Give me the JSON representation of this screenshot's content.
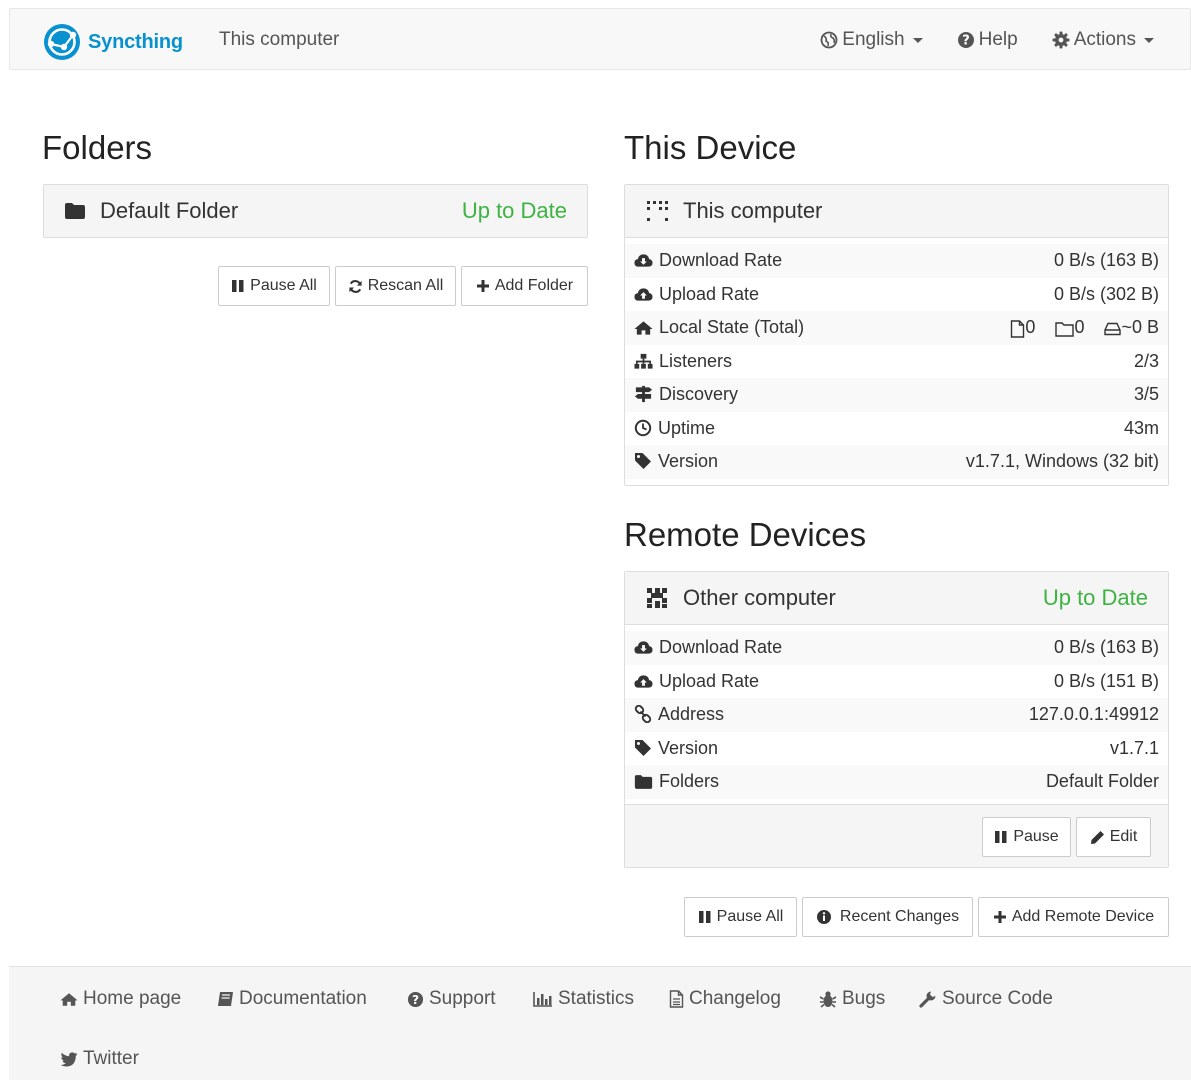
{
  "navbar": {
    "brand": "Syncthing",
    "device_name": "This computer",
    "language": "English",
    "help": "Help",
    "actions": "Actions"
  },
  "folders": {
    "heading": "Folders",
    "items": [
      {
        "name": "Default Folder",
        "status": "Up to Date"
      }
    ],
    "buttons": {
      "pause_all": "Pause All",
      "rescan_all": "Rescan All",
      "add_folder": "Add Folder"
    }
  },
  "this_device": {
    "heading": "This Device",
    "name": "This computer",
    "rows": [
      {
        "icon": "cloud-download-icon",
        "label": "Download Rate",
        "value": "0 B/s (163 B)"
      },
      {
        "icon": "cloud-upload-icon",
        "label": "Upload Rate",
        "value": "0 B/s (302 B)"
      },
      {
        "icon": "home-icon",
        "label": "Local State (Total)",
        "files": "0",
        "dirs": "0",
        "size": "~0 B"
      },
      {
        "icon": "sitemap-icon",
        "label": "Listeners",
        "value": "2/3"
      },
      {
        "icon": "signpost-icon",
        "label": "Discovery",
        "value": "3/5"
      },
      {
        "icon": "clock-icon",
        "label": "Uptime",
        "value": "43m"
      },
      {
        "icon": "tag-icon",
        "label": "Version",
        "value": "v1.7.1, Windows (32 bit)"
      }
    ]
  },
  "remote_devices": {
    "heading": "Remote Devices",
    "devices": [
      {
        "name": "Other computer",
        "status": "Up to Date",
        "rows": [
          {
            "icon": "cloud-download-icon",
            "label": "Download Rate",
            "value": "0 B/s (163 B)"
          },
          {
            "icon": "cloud-upload-icon",
            "label": "Upload Rate",
            "value": "0 B/s (151 B)"
          },
          {
            "icon": "link-icon",
            "label": "Address",
            "value": "127.0.0.1:49912"
          },
          {
            "icon": "tag-icon",
            "label": "Version",
            "value": "v1.7.1"
          },
          {
            "icon": "folder-icon",
            "label": "Folders",
            "value": "Default Folder"
          }
        ],
        "buttons": {
          "pause": "Pause",
          "edit": "Edit"
        }
      }
    ],
    "buttons": {
      "pause_all": "Pause All",
      "recent_changes": "Recent Changes",
      "add_remote_device": "Add Remote Device"
    }
  },
  "footer": {
    "links": [
      "Home page",
      "Documentation",
      "Support",
      "Statistics",
      "Changelog",
      "Bugs",
      "Source Code",
      "Twitter"
    ]
  },
  "colors": {
    "brand": "#0891d1",
    "status_ok": "#3db441"
  }
}
